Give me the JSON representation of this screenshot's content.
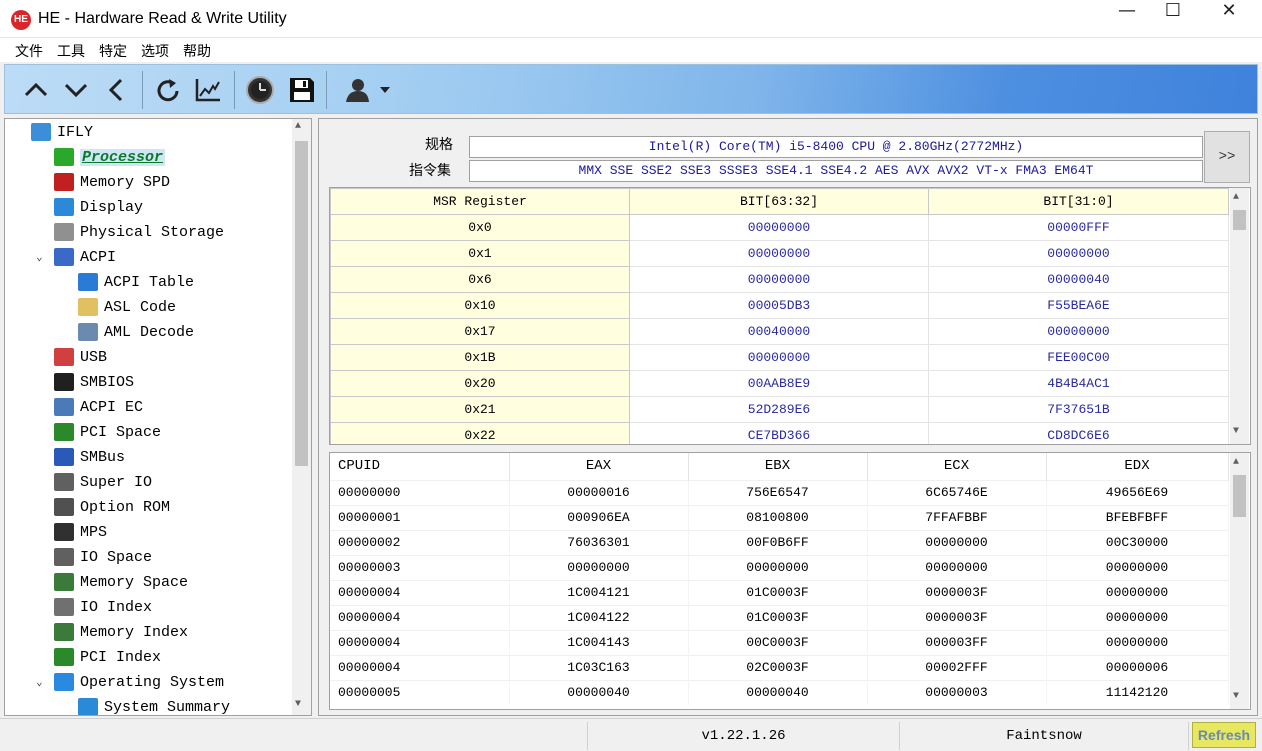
{
  "window": {
    "title": "HE - Hardware Read & Write Utility",
    "logo": "HE",
    "minimize": "—",
    "maximize": "☐",
    "close": "✕"
  },
  "menu": [
    "文件",
    "工具",
    "特定",
    "选项",
    "帮助"
  ],
  "toolbar": [
    "up-icon",
    "down-icon",
    "back-icon",
    "refresh-icon",
    "chart-icon",
    "clock-icon",
    "save-icon",
    "user-icon",
    "dropdown-icon"
  ],
  "tree": [
    {
      "label": "IFLY",
      "level": 0,
      "icon": "computer-icon",
      "color": "#3a8fd8"
    },
    {
      "label": "Processor",
      "level": 1,
      "icon": "arrow-right-icon",
      "color": "#2aa82a",
      "selected": true
    },
    {
      "label": "Memory SPD",
      "level": 1,
      "icon": "memory-spd-icon",
      "color": "#c02020"
    },
    {
      "label": "Display",
      "level": 1,
      "icon": "monitor-icon",
      "color": "#2a8ad8"
    },
    {
      "label": "Physical Storage",
      "level": 1,
      "icon": "storage-icon",
      "color": "#909090"
    },
    {
      "label": "ACPI",
      "level": 1,
      "icon": "acpi-icon",
      "color": "#3a6ac8",
      "expanded": true
    },
    {
      "label": "ACPI Table",
      "level": 2,
      "icon": "database-icon",
      "color": "#2a7ad8"
    },
    {
      "label": "ASL Code",
      "level": 2,
      "icon": "code-file-icon",
      "color": "#e0c060"
    },
    {
      "label": "AML Decode",
      "level": 2,
      "icon": "decode-icon",
      "color": "#6a8ab0"
    },
    {
      "label": "USB",
      "level": 1,
      "icon": "usb-icon",
      "color": "#d04040"
    },
    {
      "label": "SMBIOS",
      "level": 1,
      "icon": "smbios-icon",
      "color": "#202020"
    },
    {
      "label": "ACPI EC",
      "level": 1,
      "icon": "laptop-icon",
      "color": "#4a7ab8"
    },
    {
      "label": "PCI Space",
      "level": 1,
      "icon": "pci-card-icon",
      "color": "#2a8a2a"
    },
    {
      "label": "SMBus",
      "level": 1,
      "icon": "smbus-icon",
      "color": "#2a5ab8"
    },
    {
      "label": "Super IO",
      "level": 1,
      "icon": "chip-icon",
      "color": "#606060"
    },
    {
      "label": "Option ROM",
      "level": 1,
      "icon": "rom-icon",
      "color": "#505050"
    },
    {
      "label": "MPS",
      "level": 1,
      "icon": "mps-icon",
      "color": "#303030"
    },
    {
      "label": "IO Space",
      "level": 1,
      "icon": "io-icon",
      "color": "#606060"
    },
    {
      "label": "Memory Space",
      "level": 1,
      "icon": "memory-icon",
      "color": "#3a7a3a"
    },
    {
      "label": "IO Index",
      "level": 1,
      "icon": "io-index-icon",
      "color": "#707070"
    },
    {
      "label": "Memory Index",
      "level": 1,
      "icon": "memory-index-icon",
      "color": "#3a7a3a"
    },
    {
      "label": "PCI Index",
      "level": 1,
      "icon": "pci-index-icon",
      "color": "#2a8a2a"
    },
    {
      "label": "Operating System",
      "level": 1,
      "icon": "windows-icon",
      "color": "#2a8ae0",
      "expanded": true
    },
    {
      "label": "System Summary",
      "level": 2,
      "icon": "monitor-icon",
      "color": "#2a8ad8"
    }
  ],
  "spec": {
    "label": "规格",
    "value": "Intel(R) Core(TM) i5-8400 CPU @ 2.80GHz(2772MHz)"
  },
  "isa": {
    "label": "指令集",
    "value": "MMX SSE SSE2 SSE3 SSSE3 SSE4.1 SSE4.2 AES AVX AVX2 VT-x FMA3 EM64T"
  },
  "more_button": ">>",
  "msr": {
    "headers": [
      "MSR Register",
      "BIT[63:32]",
      "BIT[31:0]"
    ],
    "rows": [
      [
        "0x0",
        "00000000",
        "00000FFF"
      ],
      [
        "0x1",
        "00000000",
        "00000000"
      ],
      [
        "0x6",
        "00000000",
        "00000040"
      ],
      [
        "0x10",
        "00005DB3",
        "F55BEA6E"
      ],
      [
        "0x17",
        "00040000",
        "00000000"
      ],
      [
        "0x1B",
        "00000000",
        "FEE00C00"
      ],
      [
        "0x20",
        "00AAB8E9",
        "4B4B4AC1"
      ],
      [
        "0x21",
        "52D289E6",
        "7F37651B"
      ],
      [
        "0x22",
        "CE7BD366",
        "CD8DC6E6"
      ]
    ]
  },
  "cpuid": {
    "headers": [
      "CPUID",
      "EAX",
      "EBX",
      "ECX",
      "EDX"
    ],
    "rows": [
      [
        "00000000",
        "00000016",
        "756E6547",
        "6C65746E",
        "49656E69"
      ],
      [
        "00000001",
        "000906EA",
        "08100800",
        "7FFAFBBF",
        "BFEBFBFF"
      ],
      [
        "00000002",
        "76036301",
        "00F0B6FF",
        "00000000",
        "00C30000"
      ],
      [
        "00000003",
        "00000000",
        "00000000",
        "00000000",
        "00000000"
      ],
      [
        "00000004",
        "1C004121",
        "01C0003F",
        "0000003F",
        "00000000"
      ],
      [
        "00000004",
        "1C004122",
        "01C0003F",
        "0000003F",
        "00000000"
      ],
      [
        "00000004",
        "1C004143",
        "00C0003F",
        "000003FF",
        "00000000"
      ],
      [
        "00000004",
        "1C03C163",
        "02C0003F",
        "00002FFF",
        "00000006"
      ],
      [
        "00000005",
        "00000040",
        "00000040",
        "00000003",
        "11142120"
      ]
    ]
  },
  "status": {
    "version": "v1.22.1.26",
    "author": "Faintsnow",
    "refresh": "Refresh"
  }
}
